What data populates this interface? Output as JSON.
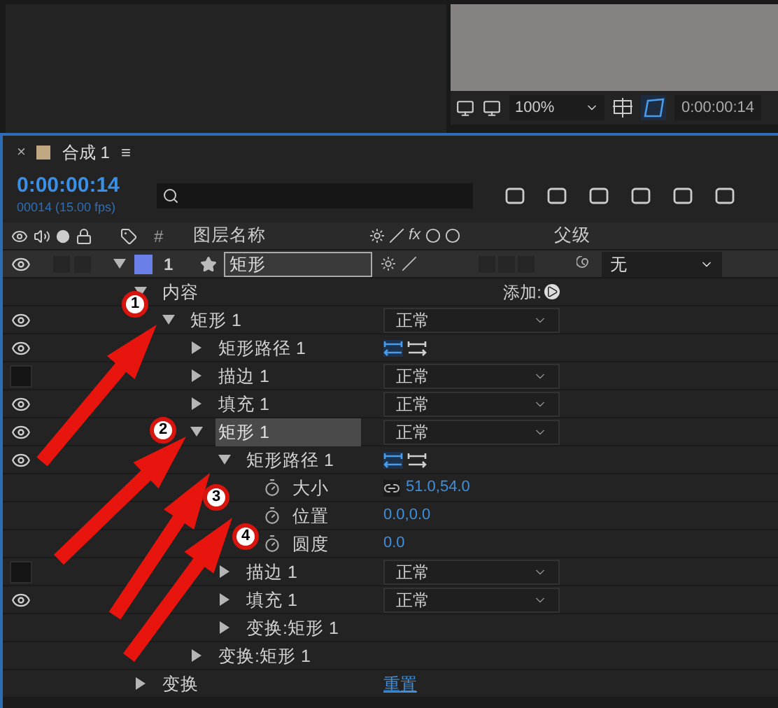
{
  "viewer": {
    "zoom": "100%",
    "timecode": "0:00:00:14"
  },
  "panel": {
    "close": "×",
    "title": "合成 1",
    "menu": "≡",
    "timecode": "0:00:00:14",
    "frame_info": "00014 (15.00 fps)"
  },
  "header": {
    "number": "#",
    "name": "图层名称",
    "fx": "fx",
    "parent": "父级"
  },
  "layer": {
    "number": "1",
    "name": "矩形",
    "parent": "无",
    "visible": true,
    "expanded": true,
    "color": "#6b7fe8"
  },
  "tree": [
    {
      "kind": "group",
      "name": "内容",
      "expanded": true,
      "right": {
        "kind": "add",
        "label": "添加:"
      },
      "children": [
        {
          "kind": "group",
          "name": "矩形 1",
          "visible": true,
          "expanded": true,
          "selected": false,
          "right": {
            "kind": "mode",
            "value": "正常"
          },
          "children": [
            {
              "kind": "group",
              "name": "矩形路径 1",
              "visible": true,
              "expanded": false,
              "selected": false,
              "right": {
                "kind": "path"
              }
            },
            {
              "kind": "group",
              "name": "描边 1",
              "visible": false,
              "expanded": false,
              "selected": false,
              "right": {
                "kind": "mode",
                "value": "正常"
              }
            },
            {
              "kind": "group",
              "name": "填充 1",
              "visible": true,
              "expanded": false,
              "selected": false,
              "right": {
                "kind": "mode",
                "value": "正常"
              }
            },
            {
              "kind": "group",
              "name": "矩形 1",
              "visible": true,
              "expanded": true,
              "selected": true,
              "right": {
                "kind": "mode",
                "value": "正常"
              },
              "children": [
                {
                  "kind": "group",
                  "name": "矩形路径 1",
                  "visible": true,
                  "expanded": true,
                  "selected": false,
                  "right": {
                    "kind": "path"
                  },
                  "children": [
                    {
                      "kind": "property",
                      "name": "大小",
                      "right": {
                        "kind": "value",
                        "value": "51.0,54.0",
                        "linked": true
                      }
                    },
                    {
                      "kind": "property",
                      "name": "位置",
                      "right": {
                        "kind": "value",
                        "value": "0.0,0.0",
                        "linked": false
                      }
                    },
                    {
                      "kind": "property",
                      "name": "圆度",
                      "right": {
                        "kind": "value",
                        "value": "0.0",
                        "linked": false
                      }
                    }
                  ]
                },
                {
                  "kind": "group",
                  "name": "描边 1",
                  "visible": false,
                  "expanded": false,
                  "selected": false,
                  "right": {
                    "kind": "mode",
                    "value": "正常"
                  }
                },
                {
                  "kind": "group",
                  "name": "填充 1",
                  "visible": true,
                  "expanded": false,
                  "selected": false,
                  "right": {
                    "kind": "mode",
                    "value": "正常"
                  }
                },
                {
                  "kind": "group",
                  "name": "变换:矩形 1",
                  "expanded": false,
                  "selected": false
                }
              ]
            },
            {
              "kind": "group",
              "name": "变换:矩形 1",
              "expanded": false,
              "selected": false
            }
          ]
        }
      ]
    },
    {
      "kind": "group",
      "name": "变换",
      "expanded": false,
      "right": {
        "kind": "link",
        "label": "重置"
      }
    }
  ],
  "annotations": [
    {
      "label": "1"
    },
    {
      "label": "2"
    },
    {
      "label": "3"
    },
    {
      "label": "4"
    }
  ]
}
